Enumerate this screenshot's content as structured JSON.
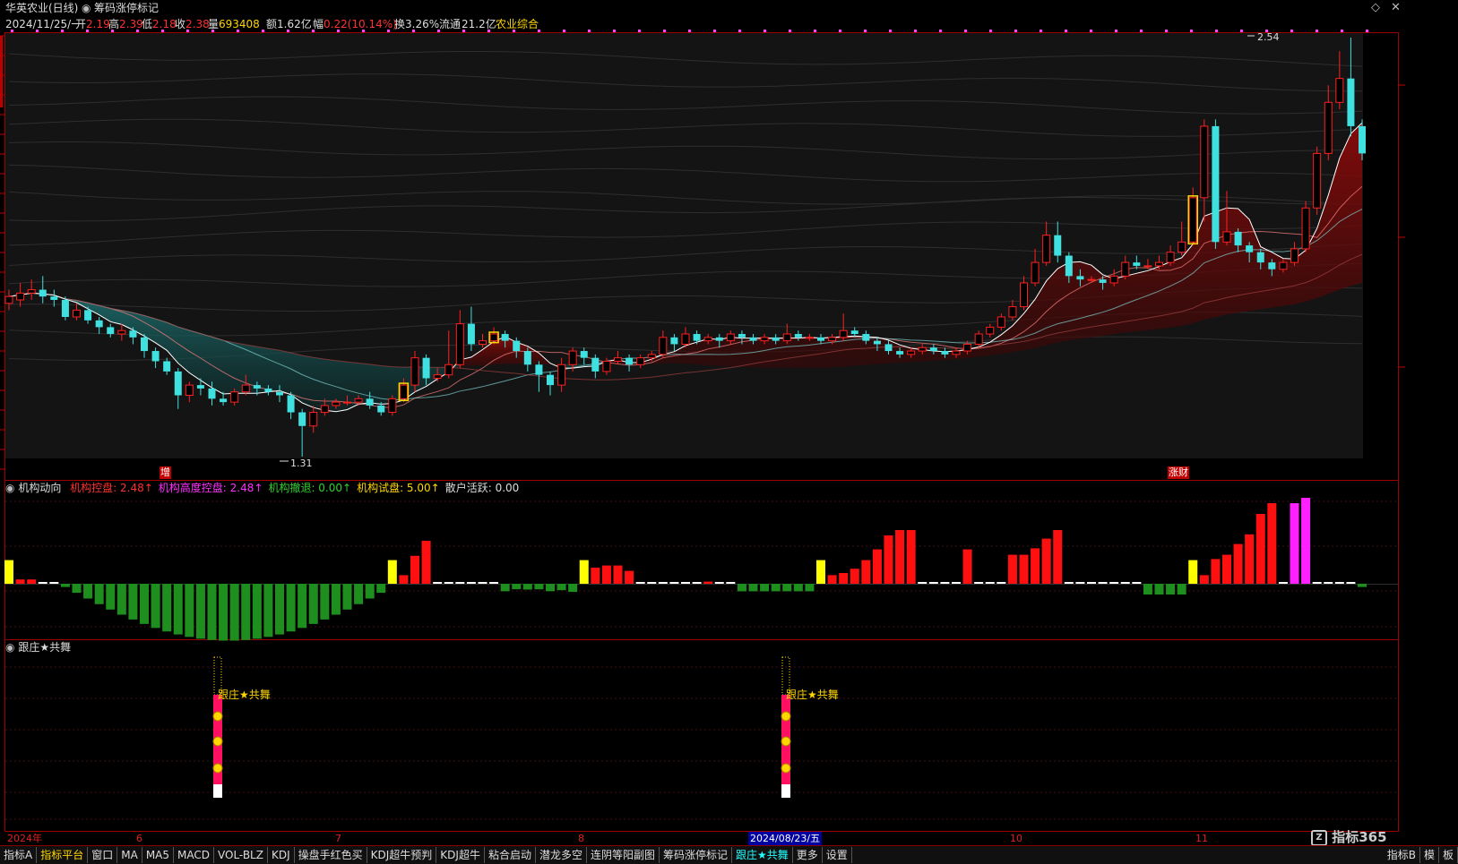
{
  "header": {
    "stock_name": "华英农业(日线)",
    "indicator_name": "筹码涨停标记",
    "date": "2024/11/25/一",
    "open_label": "开",
    "open": "2.19",
    "high_label": "高",
    "high": "2.39",
    "low_label": "低",
    "low": "2.18",
    "close_label": "收",
    "close": "2.38",
    "volume_label": "量",
    "volume": "693408",
    "amount_label": "额",
    "amount": "1.62亿",
    "change_label": "幅",
    "change": "0.22(10.14%)",
    "turnover_label": "换",
    "turnover": "3.26%",
    "float_label": "流通",
    "float": "21.2亿",
    "sector": "农业综合"
  },
  "main_chart": {
    "high_marker": "2.54",
    "low_marker": "1.31",
    "signal_left": "增",
    "signal_right": "涨财"
  },
  "panel2": {
    "title": "机构动向",
    "items": [
      {
        "label": "机构控盘:",
        "value": "2.48",
        "arrow": "↑",
        "color": "#ff3030"
      },
      {
        "label": "机构高度控盘:",
        "value": "2.48",
        "arrow": "↑",
        "color": "#ff30ff"
      },
      {
        "label": "机构撤退:",
        "value": "0.00",
        "arrow": "↑",
        "color": "#30d030"
      },
      {
        "label": "机构试盘:",
        "value": "5.00",
        "arrow": "↑",
        "color": "#ffd700"
      },
      {
        "label": "散户活跃:",
        "value": "0.00",
        "arrow": "",
        "color": "#dddddd"
      }
    ]
  },
  "panel3": {
    "title": "跟庄★共舞",
    "signal_label": "跟庄★共舞"
  },
  "date_axis": {
    "labels": [
      "2024年",
      "6",
      "7",
      "8",
      "2024/08/23/五",
      "10",
      "11"
    ]
  },
  "watermark": "指标365",
  "tabs": [
    "指标A",
    "指标平台",
    "窗口",
    "MA",
    "MA5",
    "MACD",
    "VOL-BLZ",
    "KDJ",
    "操盘手红色买",
    "KDJ超牛预判",
    "KDJ超牛",
    "粘合启动",
    "潜龙多空",
    "连阴等阳副图",
    "筹码涨停标记",
    "跟庄★共舞",
    "更多",
    "设置"
  ],
  "tabs_right": [
    "指标B",
    "模",
    "板"
  ],
  "colors": {
    "up": "#ff2020",
    "down": "#40e0e0",
    "frame": "#a00000",
    "yellow": "#ffd700",
    "magenta": "#ff20ff",
    "green": "#1e8f1e"
  }
}
